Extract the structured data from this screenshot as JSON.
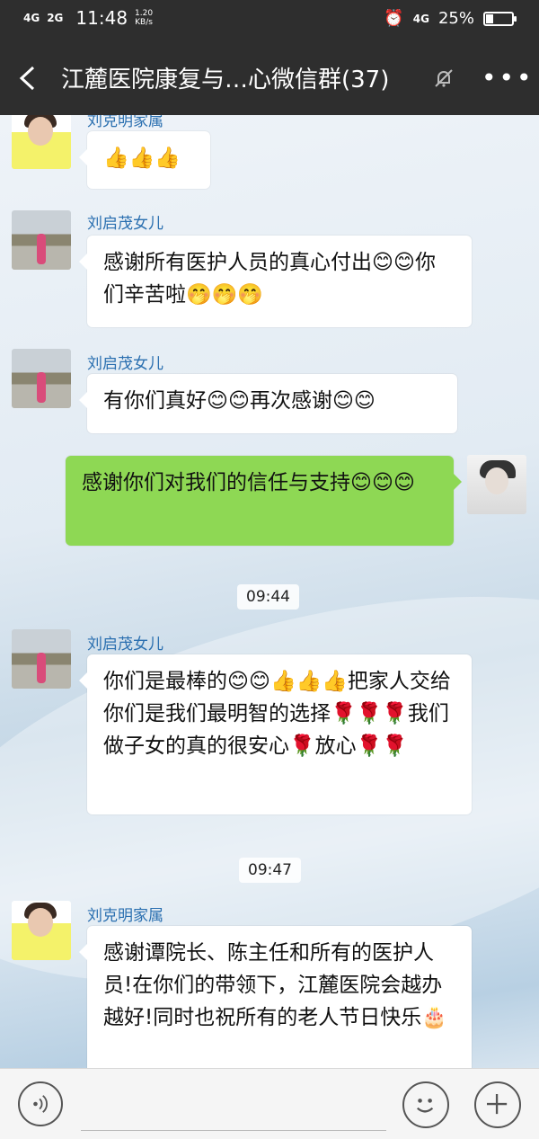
{
  "status_bar": {
    "network_1": "4G",
    "network_2": "2G",
    "time": "11:48",
    "speed_value": "1.20",
    "speed_unit": "KB/s",
    "network_3": "4G",
    "battery_text": "25%",
    "battery_level": 0.25,
    "icons": [
      "alarm-icon",
      "battery-icon",
      "signal-icon"
    ]
  },
  "header": {
    "title": "江麓医院康复与…心微信群(37)",
    "icons": [
      "back-icon",
      "mute-icon",
      "more-icon"
    ]
  },
  "messages": [
    {
      "sender": "刘克明家属",
      "text": "👍👍👍"
    },
    {
      "sender": "刘启茂女儿",
      "text": "感谢所有医护人员的真心付出😊😊你们辛苦啦🤭🤭🤭"
    },
    {
      "sender": "刘启茂女儿",
      "text": "有你们真好😊😊再次感谢😊😊"
    },
    {
      "sender": "",
      "text": "感谢你们对我们的信任与支持😊😊😊",
      "mine": true
    },
    {
      "time": "09:44"
    },
    {
      "sender": "刘启茂女儿",
      "text": "你们是最棒的😊😊👍👍👍把家人交给你们是我们最明智的选择🌹🌹🌹我们做子女的真的很安心🌹放心🌹🌹"
    },
    {
      "time": "09:47"
    },
    {
      "sender": "刘克明家属",
      "text": "感谢谭院长、陈主任和所有的医护人员!在你们的带领下，江麓医院会越办越好!同时也祝所有的老人节日快乐🎂"
    }
  ],
  "input_bar": {
    "icons": [
      "voice-icon",
      "emoji-icon",
      "plus-icon"
    ]
  }
}
